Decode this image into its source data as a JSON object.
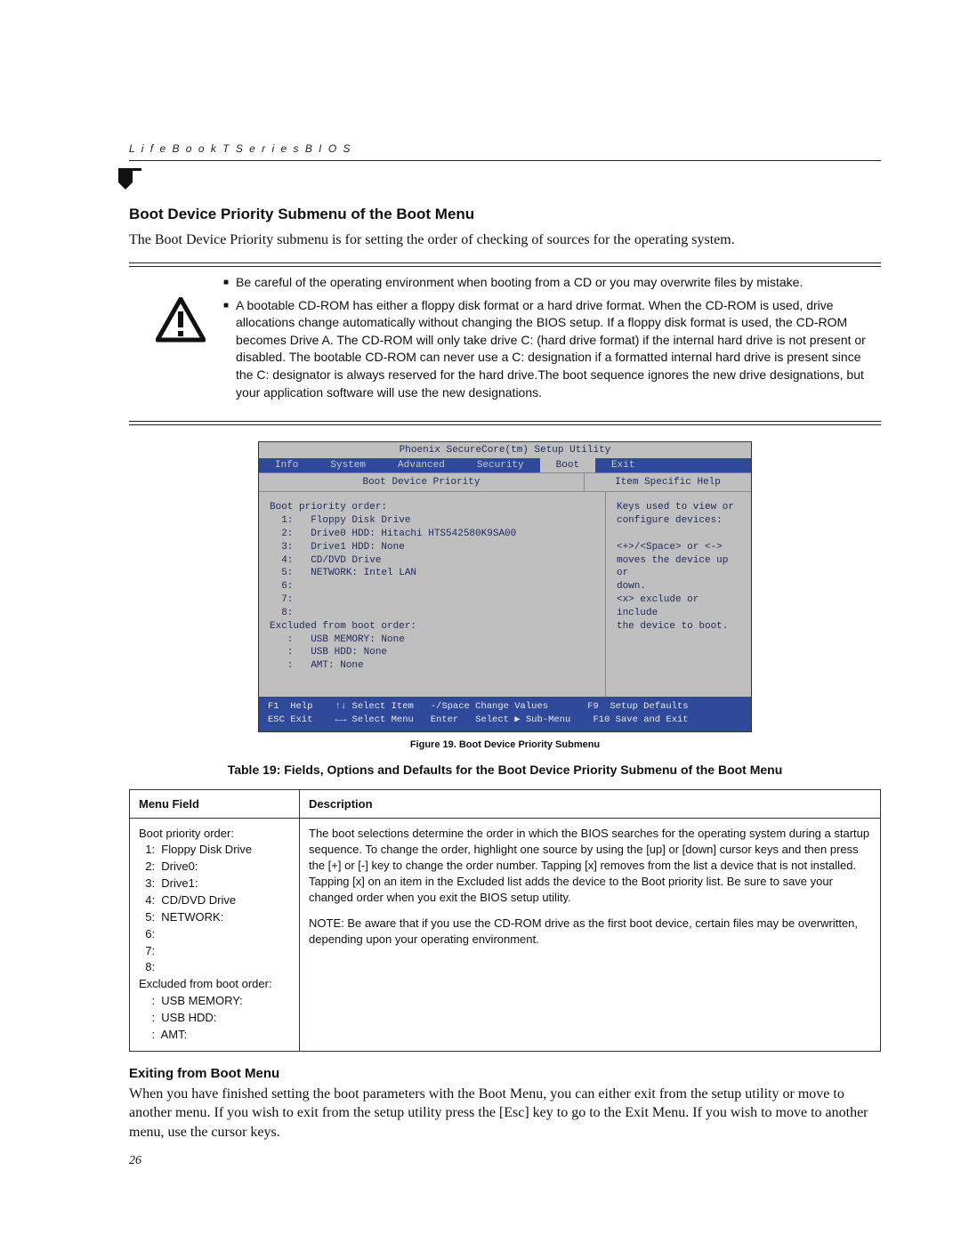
{
  "header": {
    "running": "L i f e B o o k   T   S e r i e s   B I O S"
  },
  "section": {
    "title": "Boot Device Priority Submenu of the Boot Menu",
    "intro": "The Boot Device Priority submenu is for setting the order of checking of sources for the operating system."
  },
  "warnings": [
    "Be careful of the operating environment when booting from a CD or you may overwrite files by mistake.",
    "A bootable CD-ROM has either a floppy disk format or a hard drive format. When the CD-ROM is used, drive allocations change automatically without changing the BIOS setup. If a floppy disk format is used, the CD-ROM becomes Drive A. The CD-ROM will only take drive C: (hard drive format) if the internal hard drive is not present or disabled. The bootable CD-ROM can never use a C: designation if a formatted internal hard drive is present since the C: designator is always reserved for the hard drive.The boot sequence ignores the new drive designations, but your application software will use the new designations."
  ],
  "bios": {
    "utility_title": "Phoenix SecureCore(tm) Setup Utility",
    "tabs": [
      "Info",
      "System",
      "Advanced",
      "Security",
      "Boot",
      "Exit"
    ],
    "active_tab": "Boot",
    "panel_title_left": "Boot Device Priority",
    "panel_title_right": "Item Specific Help",
    "left_body": "Boot priority order:\n  1:   Floppy Disk Drive\n  2:   Drive0 HDD: Hitachi HTS542580K9SA00\n  3:   Drive1 HDD: None\n  4:   CD/DVD Drive\n  5:   NETWORK: Intel LAN\n  6:\n  7:\n  8:\nExcluded from boot order:\n   :   USB MEMORY: None\n   :   USB HDD: None\n   :   AMT: None",
    "right_body": "Keys used to view or\nconfigure devices:\n\n<+>/<Space> or <->\nmoves the device up or\ndown.\n<x> exclude or include\nthe device to boot.",
    "footer_line1": "F1  Help    ↑↓ Select Item   -/Space Change Values       F9  Setup Defaults",
    "footer_line2": "ESC Exit    ←→ Select Menu   Enter   Select ▶ Sub-Menu    F10 Save and Exit"
  },
  "figure_caption": "Figure 19.  Boot Device Priority Submenu",
  "table_caption": "Table 19: Fields, Options and Defaults for the Boot Device Priority Submenu of the Boot Menu",
  "table": {
    "head_menu": "Menu Field",
    "head_desc": "Description",
    "menu_field": "Boot priority order:\n  1:  Floppy Disk Drive\n  2:  Drive0:\n  3:  Drive1:\n  4:  CD/DVD Drive\n  5:  NETWORK:\n  6:\n  7:\n  8:\nExcluded from boot order:\n    :  USB MEMORY:\n    :  USB HDD:\n    :  AMT:",
    "desc_p1": "The boot selections determine the order in which the BIOS searches for the operating system during a startup sequence. To change the order, highlight one source by using the [up] or [down] cursor keys and then press the [+] or [-] key to change the order number. Tapping [x] removes from the list a device that is not installed. Tapping [x] on an item in the Excluded list adds the device to the Boot priority list. Be sure to save your changed order when you exit the BIOS setup utility.",
    "desc_p2": "NOTE: Be aware that if you use the CD-ROM drive as the first boot device, certain files may be overwritten, depending upon your operating environment."
  },
  "exit": {
    "title": "Exiting from Boot Menu",
    "body": "When you have finished setting the boot parameters with the Boot Menu, you can either exit from the setup utility or move to another menu. If you wish to exit from the setup utility press the [Esc] key to go to the Exit Menu. If you wish to move to another menu, use the cursor keys."
  },
  "page_number": "26"
}
